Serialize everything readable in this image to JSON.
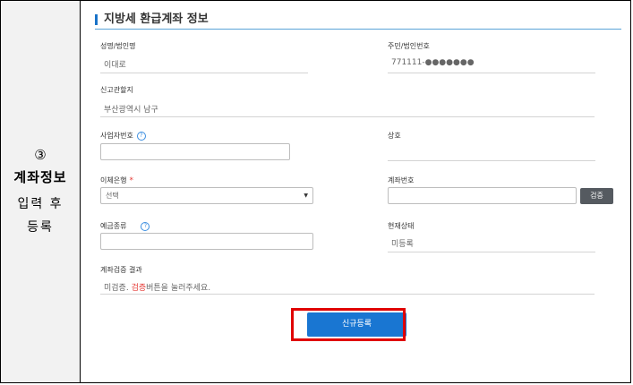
{
  "step": {
    "number": "③",
    "title": "계좌정보",
    "description": "입력 후 등록"
  },
  "section": {
    "title": "지방세 환급계좌 정보"
  },
  "fields": {
    "name_label": "성명/법인명",
    "name_value": "이대로",
    "id_label": "주민/법인번호",
    "id_value": "771111-●●●●●●●",
    "office_label": "신고관할지",
    "office_value": "부산광역시 남구",
    "biz_no_label": "사업자번호",
    "trade_name_label": "상호",
    "bank_label": "이체은행",
    "bank_required": "*",
    "bank_select": "선택",
    "account_label": "계좌번호",
    "verify_button": "검증",
    "account_type_label": "예금종류",
    "status_label": "현재상태",
    "status_value": "미등록",
    "verify_result_label": "계좌검증 결과",
    "verify_result_prefix": "미검증. ",
    "verify_result_highlight": "검증",
    "verify_result_suffix": "버튼을 눌러주세요."
  },
  "actions": {
    "submit_label": "신규등록"
  },
  "icons": {
    "help": "?",
    "caret": "▼"
  },
  "colors": {
    "accent": "#1976d2",
    "highlight": "#e00000",
    "required": "#e53935"
  }
}
